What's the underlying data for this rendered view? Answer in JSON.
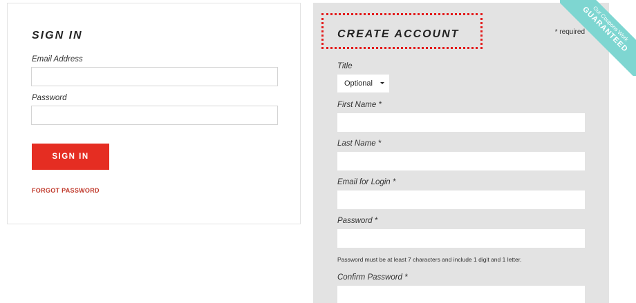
{
  "signin": {
    "heading": "SIGN IN",
    "email_label": "Email Address",
    "password_label": "Password",
    "button_label": "SIGN IN",
    "forgot_label": "FORGOT PASSWORD"
  },
  "create_account": {
    "heading": "CREATE ACCOUNT",
    "required_note": "* required",
    "title_label": "Title",
    "title_value": "Optional",
    "first_name_label": "First Name *",
    "last_name_label": "Last Name *",
    "email_label": "Email for Login *",
    "password_label": "Password *",
    "password_hint": "Password must be at least 7 characters and include 1 digit and 1 letter.",
    "confirm_password_label": "Confirm Password *"
  },
  "badge": {
    "line1": "Our Coupons Work",
    "line2": "GUARANTEED",
    "icon": "checkmark-document-icon",
    "color": "#7ed6d1"
  },
  "colors": {
    "accent": "#e52d22",
    "highlight_border": "#e31c1c",
    "panel_bg": "#e3e3e3"
  }
}
